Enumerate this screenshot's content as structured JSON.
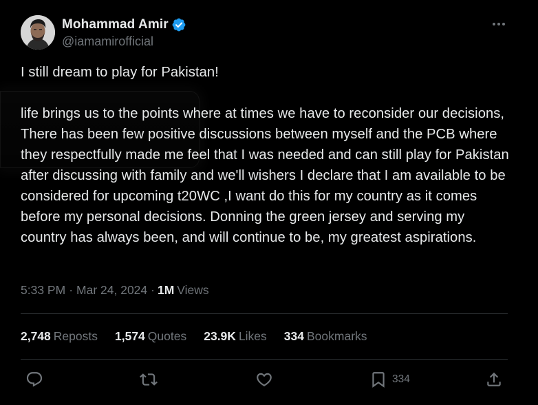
{
  "author": {
    "display_name": "Mohammad Amir",
    "handle": "@iamamirofficial",
    "verified": true
  },
  "tweet": {
    "paragraphs": [
      "I still dream to play for Pakistan!",
      "life brings us to the points where at times we have to reconsider our decisions, There has been few positive discussions between myself and the PCB where they respectfully made me feel that I was needed and can still play for Pakistan after discussing with family and we'll wishers I declare that I am available to be considered for upcoming t20WC ,I want do this for my country as it comes before my personal decisions. Donning the green jersey and serving my country has always been, and will continue to be, my greatest aspirations."
    ],
    "time": "5:33 PM",
    "separator": "·",
    "date": "Mar 24, 2024",
    "views_count": "1M",
    "views_label": "Views"
  },
  "stats": [
    {
      "count": "2,748",
      "label": "Reposts"
    },
    {
      "count": "1,574",
      "label": "Quotes"
    },
    {
      "count": "23.9K",
      "label": "Likes"
    },
    {
      "count": "334",
      "label": "Bookmarks"
    }
  ],
  "actions": {
    "reply_icon": "reply-icon",
    "retweet_icon": "retweet-icon",
    "like_icon": "heart-icon",
    "bookmark_icon": "bookmark-icon",
    "bookmark_count": "334",
    "share_icon": "share-icon"
  },
  "colors": {
    "background": "#000000",
    "text": "#e7e9ea",
    "muted": "#71767b",
    "verified": "#1d9bf0",
    "divider": "#2f3336"
  }
}
